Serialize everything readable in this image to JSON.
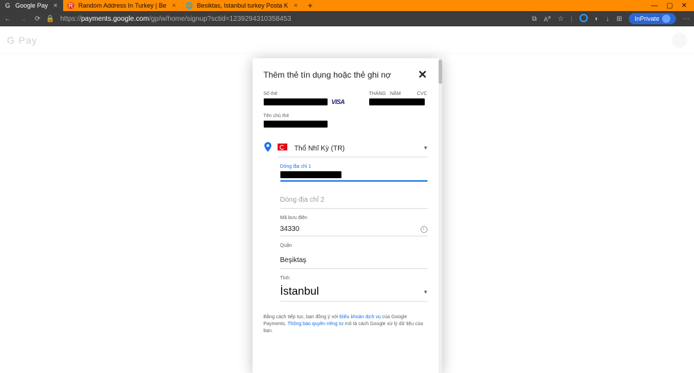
{
  "browser": {
    "tabs": [
      {
        "label": "Google Pay",
        "active": true
      },
      {
        "label": "Random Address In Turkey | Be",
        "active": false
      },
      {
        "label": "Besiktas, Istanbul turkey Posta K",
        "active": false
      }
    ],
    "url_prefix": "https://",
    "url_host": "payments.google.com",
    "url_path": "/gp/w/home/signup?sctid=1239294310358453",
    "inprivate_label": "InPrivate"
  },
  "page": {
    "logo": "G Pay"
  },
  "modal": {
    "title": "Thêm thẻ tín dụng hoặc thẻ ghi nợ",
    "card_number_label": "Số thẻ",
    "card_brand": "VISA",
    "month_label": "THÁNG",
    "year_label": "NĂM",
    "cvc_label": "CVC",
    "cardholder_label": "Tên chủ thẻ",
    "country_name": "Thổ Nhĩ Kỳ (TR)",
    "address1_label": "Dòng địa chỉ 1",
    "address2_placeholder": "Dòng địa chỉ 2",
    "postal_label": "Mã bưu điện",
    "postal_value": "34330",
    "district_label": "Quận",
    "district_value": "Beşiktaş",
    "province_label": "Tỉnh",
    "province_value": "İstanbul",
    "terms_pre": "Bằng cách tiếp tục, bạn đồng ý với ",
    "terms_link1": "Điều khoản dịch vụ",
    "terms_mid": " của Google Payments. ",
    "terms_link2": "Thông báo quyền riêng tư",
    "terms_post": " mô tả cách Google xử lý dữ liệu của bạn."
  }
}
